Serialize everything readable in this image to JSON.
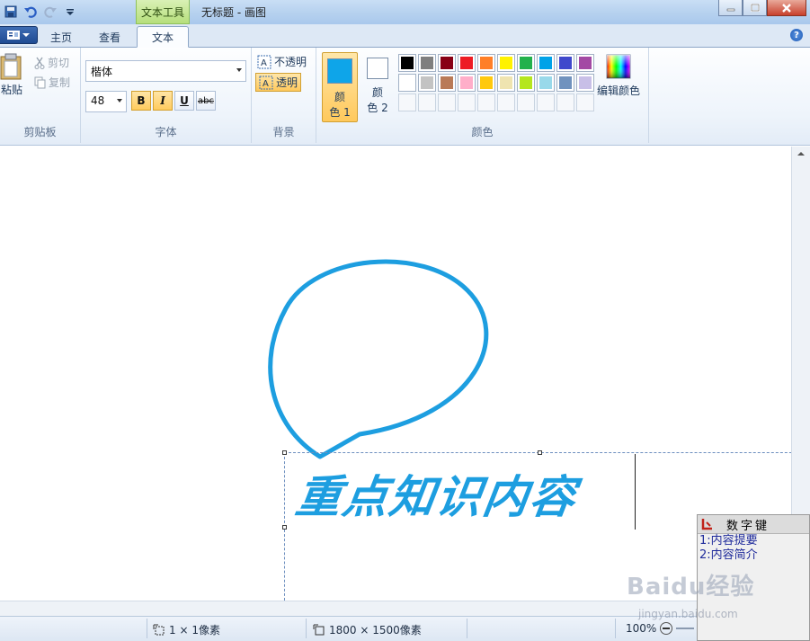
{
  "window": {
    "title": "无标题 - 画图",
    "context_tab": "文本工具"
  },
  "tabs": [
    {
      "label": "主页"
    },
    {
      "label": "查看"
    },
    {
      "label": "文本"
    }
  ],
  "clipboard": {
    "paste": "粘贴",
    "cut": "剪切",
    "copy": "复制",
    "group": "剪贴板"
  },
  "font": {
    "family": "楷体",
    "size": "48",
    "bold": "B",
    "italic": "I",
    "underline": "U",
    "strike": "abc",
    "group": "字体"
  },
  "background": {
    "opaque": "不透明",
    "transparent": "透明",
    "group": "背景"
  },
  "colors": {
    "color1_line1": "颜",
    "color1_line2": "色 1",
    "color2_line1": "颜",
    "color2_line2": "色 2",
    "color1": "#0ea5e9",
    "color2": "#ffffff",
    "edit": "编辑颜色",
    "group": "颜色",
    "palette": [
      "#000000",
      "#7f7f7f",
      "#880015",
      "#ed1c24",
      "#ff7f27",
      "#fff200",
      "#22b14c",
      "#00a2e8",
      "#3f48cc",
      "#a349a4",
      "#ffffff",
      "#c3c3c3",
      "#b97a57",
      "#ffaec9",
      "#ffc90e",
      "#efe4b0",
      "#b5e61d",
      "#99d9ea",
      "#7092be",
      "#c8bfe7"
    ]
  },
  "canvas": {
    "text": "重点知识内容",
    "stroke": "#1d9ee0"
  },
  "ime": {
    "title": "数字键",
    "candidates": [
      "1:内容提要",
      "2:内容简介"
    ]
  },
  "status": {
    "selection": "1 × 1像素",
    "image_size": "1800 × 1500像素",
    "zoom": "100%"
  },
  "watermark": {
    "brand": "Baidu经验",
    "url": "jingyan.baidu.com"
  }
}
